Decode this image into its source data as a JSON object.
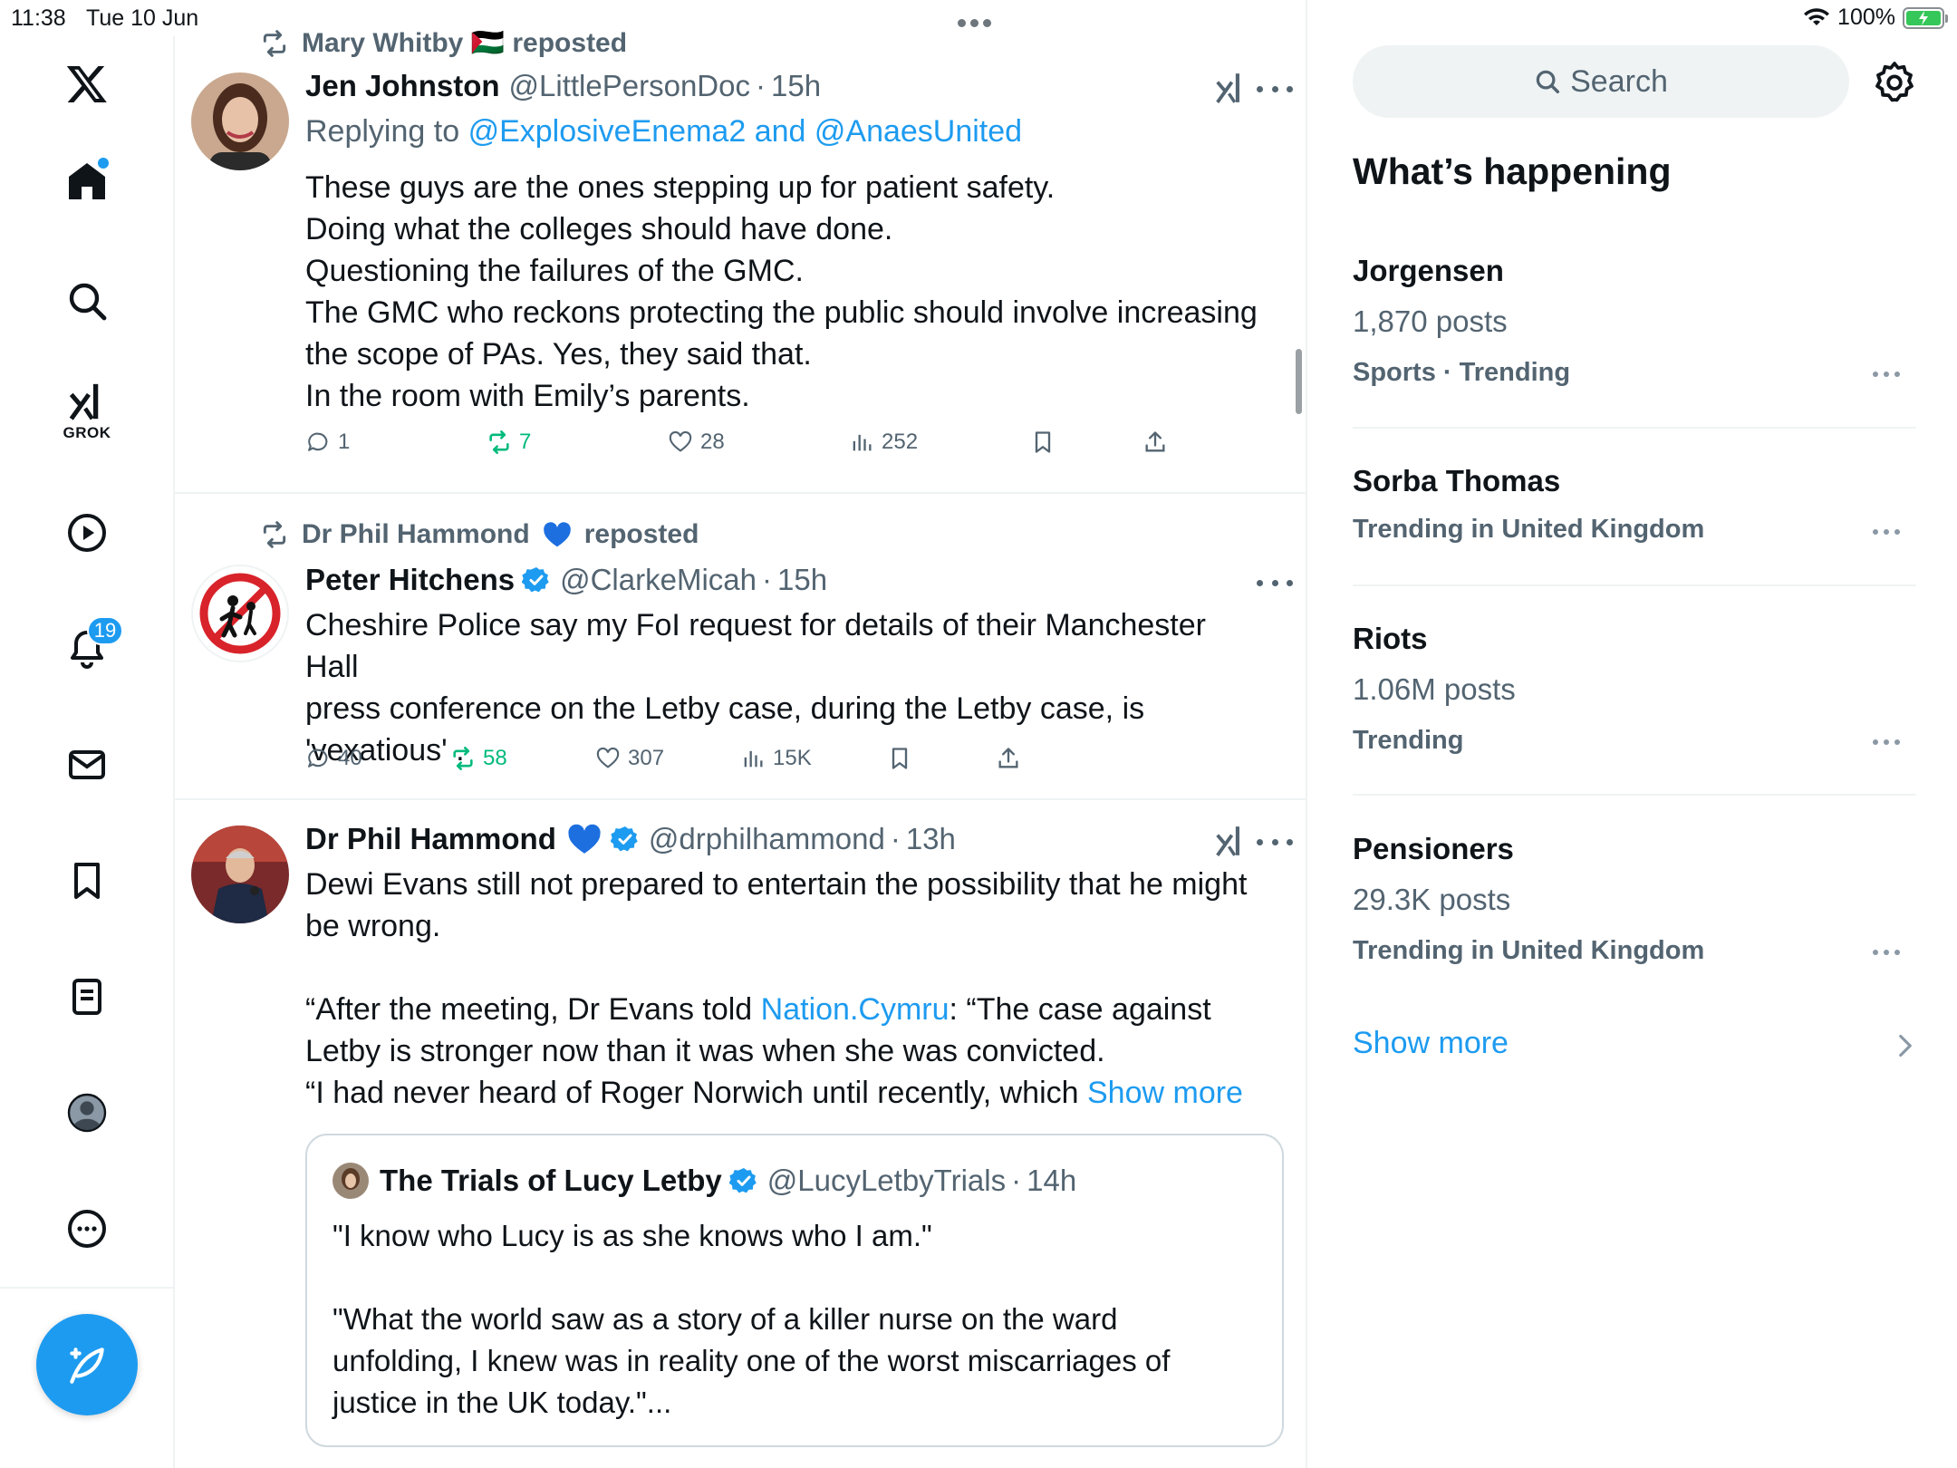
{
  "status_bar": {
    "time": "11:38",
    "date": "Tue 10 Jun",
    "battery": "100%"
  },
  "sidebar": {
    "grok_label": "GROK",
    "notification_count": "19"
  },
  "tweets": [
    {
      "repost_by": "Mary Whitby 🇵🇸 reposted",
      "name": "Jen Johnston",
      "handle": "@LittlePersonDoc",
      "time": "15h",
      "reply_prefix": "Replying to",
      "reply_to_1": "@ExplosiveEnema2",
      "reply_and": "and",
      "reply_to_2": "@AnaesUnited",
      "lines": [
        "These guys are the ones stepping up for patient safety.",
        "Doing what the colleges should have done.",
        "Questioning the failures of the GMC.",
        "The GMC who reckons protecting the public should involve increasing",
        "the scope of PAs. Yes, they said that.",
        "In the room with Emily’s parents."
      ],
      "replies": "1",
      "reposts": "7",
      "likes": "28",
      "views": "252"
    },
    {
      "repost_by": "Dr Phil Hammond 💙 reposted",
      "repost_name": "Dr Phil Hammond",
      "repost_suffix": "reposted",
      "name": "Peter Hitchens",
      "handle": "@ClarkeMicah",
      "time": "15h",
      "lines": [
        "Cheshire Police say my FoI request for details of their Manchester Hall",
        "press conference on the Letby case, during the Letby case, is",
        "'vexatious' ."
      ],
      "replies": "40",
      "reposts": "58",
      "likes": "307",
      "views": "15K"
    },
    {
      "name": "Dr Phil Hammond",
      "handle": "@drphilhammond",
      "time": "13h",
      "line1": "Dewi Evans still not prepared to entertain the possibility that he might",
      "line2": "be wrong.",
      "line3_pre": "“After the meeting, Dr Evans told ",
      "line3_link": "Nation.Cymru",
      "line3_post": ": “The case against",
      "line4": "Letby is stronger now than it was when she was convicted.",
      "line5": "“I had never heard of Roger Norwich until recently, which ",
      "show_more": "Show more",
      "quote": {
        "name": "The Trials of Lucy Letby",
        "handle": "@LucyLetbyTrials",
        "time": "14h",
        "line1": "\"I know who Lucy is as she knows who I am.\"",
        "line2": "\"What the world saw as a story of a killer nurse on the ward",
        "line3": "unfolding, I knew was in reality one of the worst miscarriages of",
        "line4": "justice in the UK today.\"..."
      }
    }
  ],
  "right": {
    "search_placeholder": "Search",
    "title": "What’s happening",
    "trends": [
      {
        "name": "Jorgensen",
        "posts": "1,870 posts",
        "category": "Sports · Trending"
      },
      {
        "name": "Sorba Thomas",
        "category": "Trending in United Kingdom"
      },
      {
        "name": "Riots",
        "posts": "1.06M posts",
        "category": "Trending"
      },
      {
        "name": "Pensioners",
        "posts": "29.3K posts",
        "category": "Trending in United Kingdom"
      }
    ],
    "show_more": "Show more"
  },
  "colors": {
    "accent": "#1d9bf0",
    "repost_green": "#00ba7c",
    "secondary_text": "#536471"
  }
}
